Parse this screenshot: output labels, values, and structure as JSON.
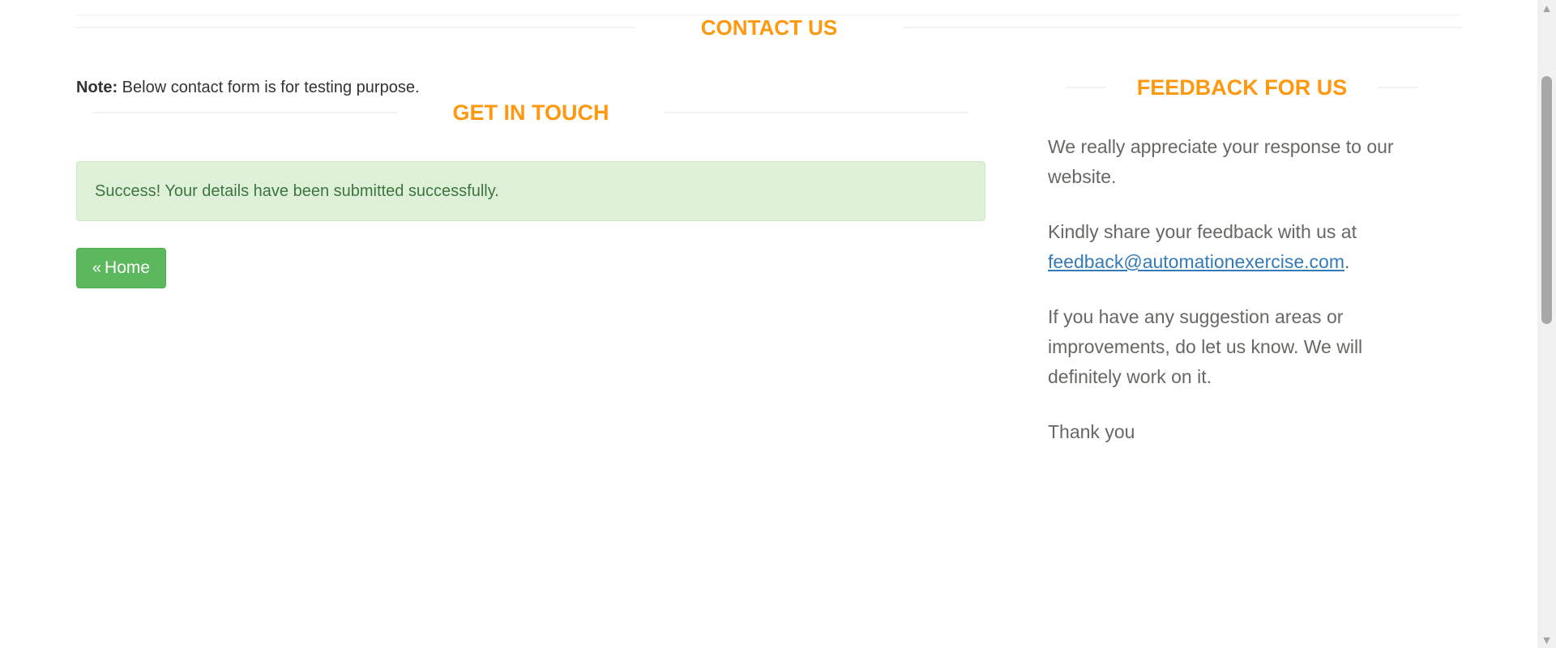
{
  "contact": {
    "title": "CONTACT US",
    "note_label": "Note:",
    "note_text": " Below contact form is for testing purpose."
  },
  "get_in_touch": {
    "title": "GET IN TOUCH",
    "success_message": "Success! Your details have been submitted successfully.",
    "home_button": "Home",
    "home_icon": "double-chevron-left-icon"
  },
  "feedback": {
    "title": "FEEDBACK FOR US",
    "para1": "We really appreciate your response to our website.",
    "para2_text": "Kindly share your feedback with us at ",
    "para2_email": "feedback@automationexercise.com",
    "para2_end": ".",
    "para3": "If you have any suggestion areas or improvements, do let us know. We will definitely work on it.",
    "para4": "Thank you"
  },
  "colors": {
    "accent": "#FE980F",
    "success_bg": "#dff0d8",
    "success_text": "#3c763d",
    "button_green": "#5cb85c",
    "link": "#337ab7"
  }
}
